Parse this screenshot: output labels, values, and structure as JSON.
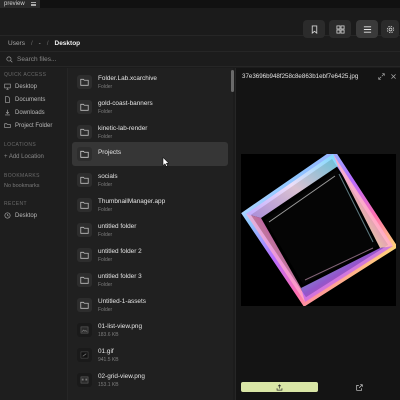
{
  "app": {
    "tab_label": "preview"
  },
  "breadcrumb": {
    "items": [
      "Users",
      "-"
    ],
    "current": "Desktop"
  },
  "search": {
    "placeholder": "Search files..."
  },
  "sidebar": {
    "quick_access": {
      "title": "QUICK ACCESS",
      "items": [
        {
          "label": "Desktop",
          "icon": "monitor-icon"
        },
        {
          "label": "Documents",
          "icon": "document-icon"
        },
        {
          "label": "Downloads",
          "icon": "download-icon"
        },
        {
          "label": "Project Folder",
          "icon": "folder-icon"
        }
      ]
    },
    "locations": {
      "title": "LOCATIONS",
      "add_label": "+ Add Location"
    },
    "bookmarks": {
      "title": "BOOKMARKS",
      "empty_label": "No bookmarks"
    },
    "recent": {
      "title": "RECENT",
      "items": [
        {
          "label": "Desktop",
          "icon": "clock-icon"
        }
      ]
    }
  },
  "files": [
    {
      "name": "Folder.Lab.xcarchive",
      "sub": "Folder",
      "kind": "folder"
    },
    {
      "name": "gold-coast-banners",
      "sub": "Folder",
      "kind": "folder"
    },
    {
      "name": "kinetic-lab-render",
      "sub": "Folder",
      "kind": "folder"
    },
    {
      "name": "Projects",
      "sub": "Folder",
      "kind": "folder",
      "selected": true
    },
    {
      "name": "socials",
      "sub": "Folder",
      "kind": "folder"
    },
    {
      "name": "ThumbnailManager.app",
      "sub": "Folder",
      "kind": "folder"
    },
    {
      "name": "untitled folder",
      "sub": "Folder",
      "kind": "folder"
    },
    {
      "name": "untitled folder 2",
      "sub": "Folder",
      "kind": "folder"
    },
    {
      "name": "untitled folder 3",
      "sub": "Folder",
      "kind": "folder"
    },
    {
      "name": "Untitled-1-assets",
      "sub": "Folder",
      "kind": "folder"
    },
    {
      "name": "01-list-view.png",
      "sub": "183.6 KB",
      "kind": "image"
    },
    {
      "name": "01.gif",
      "sub": "941.5 KB",
      "kind": "image"
    },
    {
      "name": "02-grid-view.png",
      "sub": "153.1 KB",
      "kind": "image"
    }
  ],
  "preview": {
    "filename": "37e3696b948f258c8e863b1ebf7e6425.jpg"
  },
  "colors": {
    "accent": "#d9e6a6",
    "background": "#1c1c1c"
  }
}
